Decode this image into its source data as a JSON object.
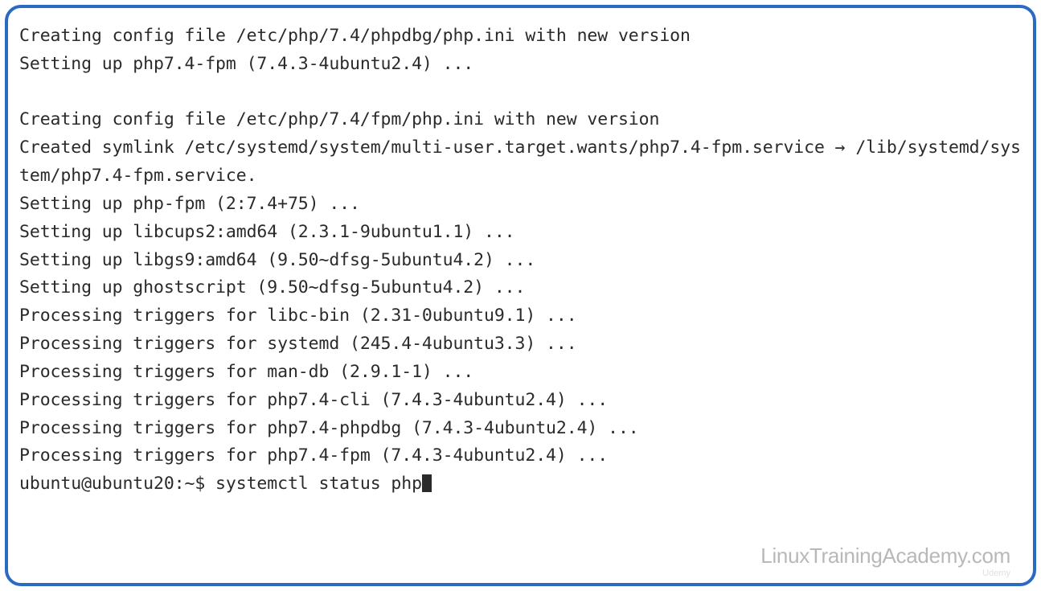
{
  "terminal": {
    "lines": [
      "Creating config file /etc/php/7.4/phpdbg/php.ini with new version",
      "Setting up php7.4-fpm (7.4.3-4ubuntu2.4) ...",
      "",
      "Creating config file /etc/php/7.4/fpm/php.ini with new version",
      "Created symlink /etc/systemd/system/multi-user.target.wants/php7.4-fpm.service → /lib/systemd/system/php7.4-fpm.service.",
      "Setting up php-fpm (2:7.4+75) ...",
      "Setting up libcups2:amd64 (2.3.1-9ubuntu1.1) ...",
      "Setting up libgs9:amd64 (9.50~dfsg-5ubuntu4.2) ...",
      "Setting up ghostscript (9.50~dfsg-5ubuntu4.2) ...",
      "Processing triggers for libc-bin (2.31-0ubuntu9.1) ...",
      "Processing triggers for systemd (245.4-4ubuntu3.3) ...",
      "Processing triggers for man-db (2.9.1-1) ...",
      "Processing triggers for php7.4-cli (7.4.3-4ubuntu2.4) ...",
      "Processing triggers for php7.4-phpdbg (7.4.3-4ubuntu2.4) ...",
      "Processing triggers for php7.4-fpm (7.4.3-4ubuntu2.4) ..."
    ],
    "prompt": "ubuntu@ubuntu20:~$ ",
    "command": "systemctl status php"
  },
  "watermark": {
    "main": "LinuxTrainingAcademy.com",
    "sub": "Udemy"
  }
}
